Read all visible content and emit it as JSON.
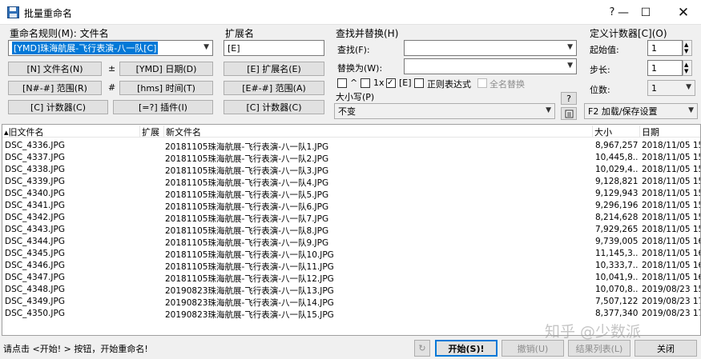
{
  "window": {
    "title": "批量重命名",
    "help": "?",
    "minimize": "—",
    "maximize": "☐",
    "close": "✕"
  },
  "rename_rule": {
    "label": "重命名规则(M): 文件名",
    "value": "[YMD]珠海航展-飞行表演-八一队[C]",
    "buttons": [
      "[N] 文件名(N)",
      "[YMD] 日期(D)",
      "[N#-#] 范围(R)",
      "[hms] 时间(T)",
      "[C] 计数器(C)",
      "[=?] 插件(I)"
    ],
    "seps": [
      "±",
      "#"
    ]
  },
  "extension": {
    "label": "扩展名",
    "value": "[E]",
    "buttons": [
      "[E] 扩展名(E)",
      "[E#-#] 范围(A)",
      "[C] 计数器(C)"
    ]
  },
  "find_replace": {
    "label": "查找并替换(H)",
    "find_label": "查找(F):",
    "replace_label": "替换为(W):",
    "find_value": "",
    "replace_value": "",
    "opt_caret": "^",
    "opt_1x": "1x",
    "opt_e": "[E]",
    "opt_regex": "正则表达式",
    "opt_fullname": "全名替换",
    "case_label": "大小写(P)",
    "case_value": "不变"
  },
  "counter": {
    "label": "定义计数器[C](O)",
    "start_label": "起始值:",
    "start_value": "1",
    "step_label": "步长:",
    "step_value": "1",
    "digits_label": "位数:",
    "digits_value": "1",
    "help_button": "?",
    "load_save": "F2 加载/保存设置"
  },
  "list": {
    "headers": [
      "旧文件名",
      "扩展",
      "新文件名",
      "大小",
      "日期"
    ],
    "rows": [
      {
        "old": "DSC_4336.JPG",
        "new": "20181105珠海航展-飞行表演-八一队1.JPG",
        "size": "8,967,257",
        "date": "2018/11/05 15:"
      },
      {
        "old": "DSC_4337.JPG",
        "new": "20181105珠海航展-飞行表演-八一队2.JPG",
        "size": "10,445,8...",
        "date": "2018/11/05 15:"
      },
      {
        "old": "DSC_4338.JPG",
        "new": "20181105珠海航展-飞行表演-八一队3.JPG",
        "size": "10,029,4...",
        "date": "2018/11/05 15:"
      },
      {
        "old": "DSC_4339.JPG",
        "new": "20181105珠海航展-飞行表演-八一队4.JPG",
        "size": "9,128,821",
        "date": "2018/11/05 15:"
      },
      {
        "old": "DSC_4340.JPG",
        "new": "20181105珠海航展-飞行表演-八一队5.JPG",
        "size": "9,129,943",
        "date": "2018/11/05 15:"
      },
      {
        "old": "DSC_4341.JPG",
        "new": "20181105珠海航展-飞行表演-八一队6.JPG",
        "size": "9,296,196",
        "date": "2018/11/05 15:"
      },
      {
        "old": "DSC_4342.JPG",
        "new": "20181105珠海航展-飞行表演-八一队7.JPG",
        "size": "8,214,628",
        "date": "2018/11/05 15:"
      },
      {
        "old": "DSC_4343.JPG",
        "new": "20181105珠海航展-飞行表演-八一队8.JPG",
        "size": "7,929,265",
        "date": "2018/11/05 15:"
      },
      {
        "old": "DSC_4344.JPG",
        "new": "20181105珠海航展-飞行表演-八一队9.JPG",
        "size": "9,739,005",
        "date": "2018/11/05 16:"
      },
      {
        "old": "DSC_4345.JPG",
        "new": "20181105珠海航展-飞行表演-八一队10.JPG",
        "size": "11,145,3...",
        "date": "2018/11/05 16:"
      },
      {
        "old": "DSC_4346.JPG",
        "new": "20181105珠海航展-飞行表演-八一队11.JPG",
        "size": "10,333,7...",
        "date": "2018/11/05 16:"
      },
      {
        "old": "DSC_4347.JPG",
        "new": "20181105珠海航展-飞行表演-八一队12.JPG",
        "size": "10,041,9...",
        "date": "2018/11/05 16:"
      },
      {
        "old": "DSC_4348.JPG",
        "new": "20190823珠海航展-飞行表演-八一队13.JPG",
        "size": "10,070,8...",
        "date": "2019/08/23 15:"
      },
      {
        "old": "DSC_4349.JPG",
        "new": "20190823珠海航展-飞行表演-八一队14.JPG",
        "size": "7,507,122",
        "date": "2019/08/23 17:"
      },
      {
        "old": "DSC_4350.JPG",
        "new": "20190823珠海航展-飞行表演-八一队15.JPG",
        "size": "8,377,340",
        "date": "2019/08/23 17:"
      }
    ]
  },
  "status": {
    "text": "请点击 <开始! > 按钮，开始重命名!",
    "refresh_icon": "↻"
  },
  "actions": {
    "start": "开始(S)!",
    "undo": "撤销(U)",
    "results": "结果列表(L)",
    "close": "关闭"
  },
  "watermark": "知乎 @少数派"
}
